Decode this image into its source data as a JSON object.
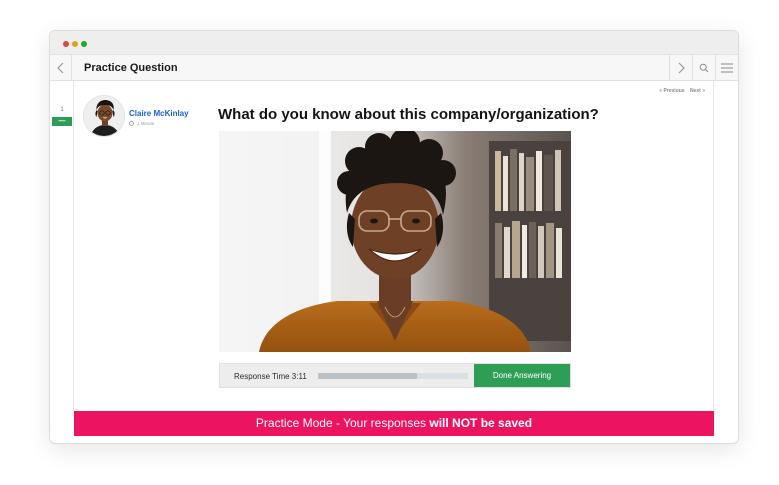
{
  "window": {
    "title": "Practice Question"
  },
  "colors": {
    "accent_green": "#2e9e57",
    "banner_pink": "#ec1360",
    "link_blue": "#1b5fd6"
  },
  "sidebar": {
    "question_number": "1",
    "indicator": "—"
  },
  "pager": {
    "previous": "« Previous",
    "next": "Next »"
  },
  "candidate": {
    "name": "Claire McKinlay",
    "duration": "1 Minute"
  },
  "question": {
    "text": "What do you know about this company/organization?"
  },
  "controls": {
    "response_time_label": "Response Time 3:11",
    "progress": 0.66,
    "done_label": "Done Answering"
  },
  "banner": {
    "prefix": "Practice Mode - Your responses ",
    "emphasis": "will NOT be saved"
  },
  "icons": {
    "back": "chevron-left-icon",
    "forward": "chevron-right-icon",
    "search": "search-icon",
    "menu": "hamburger-menu-icon"
  }
}
